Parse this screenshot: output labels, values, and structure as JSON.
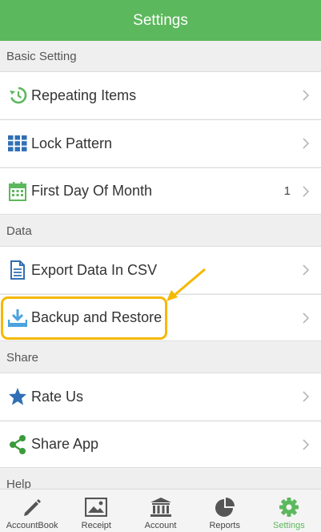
{
  "header": {
    "title": "Settings"
  },
  "sections": {
    "basic": "Basic Setting",
    "data": "Data",
    "share": "Share",
    "help": "Help"
  },
  "rows": {
    "repeating": {
      "label": "Repeating Items",
      "icon": "history-icon"
    },
    "lock": {
      "label": "Lock Pattern",
      "icon": "grid-icon"
    },
    "first_day": {
      "label": "First Day Of Month",
      "value": "1",
      "icon": "calendar-icon"
    },
    "export": {
      "label": "Export Data In CSV",
      "icon": "document-icon"
    },
    "backup": {
      "label": "Backup and Restore",
      "icon": "download-icon"
    },
    "rate": {
      "label": "Rate Us",
      "icon": "star-icon"
    },
    "share_app": {
      "label": "Share App",
      "icon": "share-icon"
    }
  },
  "tabs": [
    {
      "label": "AccountBook",
      "icon": "pencil-icon"
    },
    {
      "label": "Receipt",
      "icon": "image-icon"
    },
    {
      "label": "Account",
      "icon": "bank-icon"
    },
    {
      "label": "Reports",
      "icon": "pie-chart-icon"
    },
    {
      "label": "Settings",
      "icon": "gear-icon",
      "active": true
    }
  ],
  "colors": {
    "accent": "#5cb85c",
    "blue_icon": "#2f6fb5",
    "highlight": "#f5b800"
  }
}
